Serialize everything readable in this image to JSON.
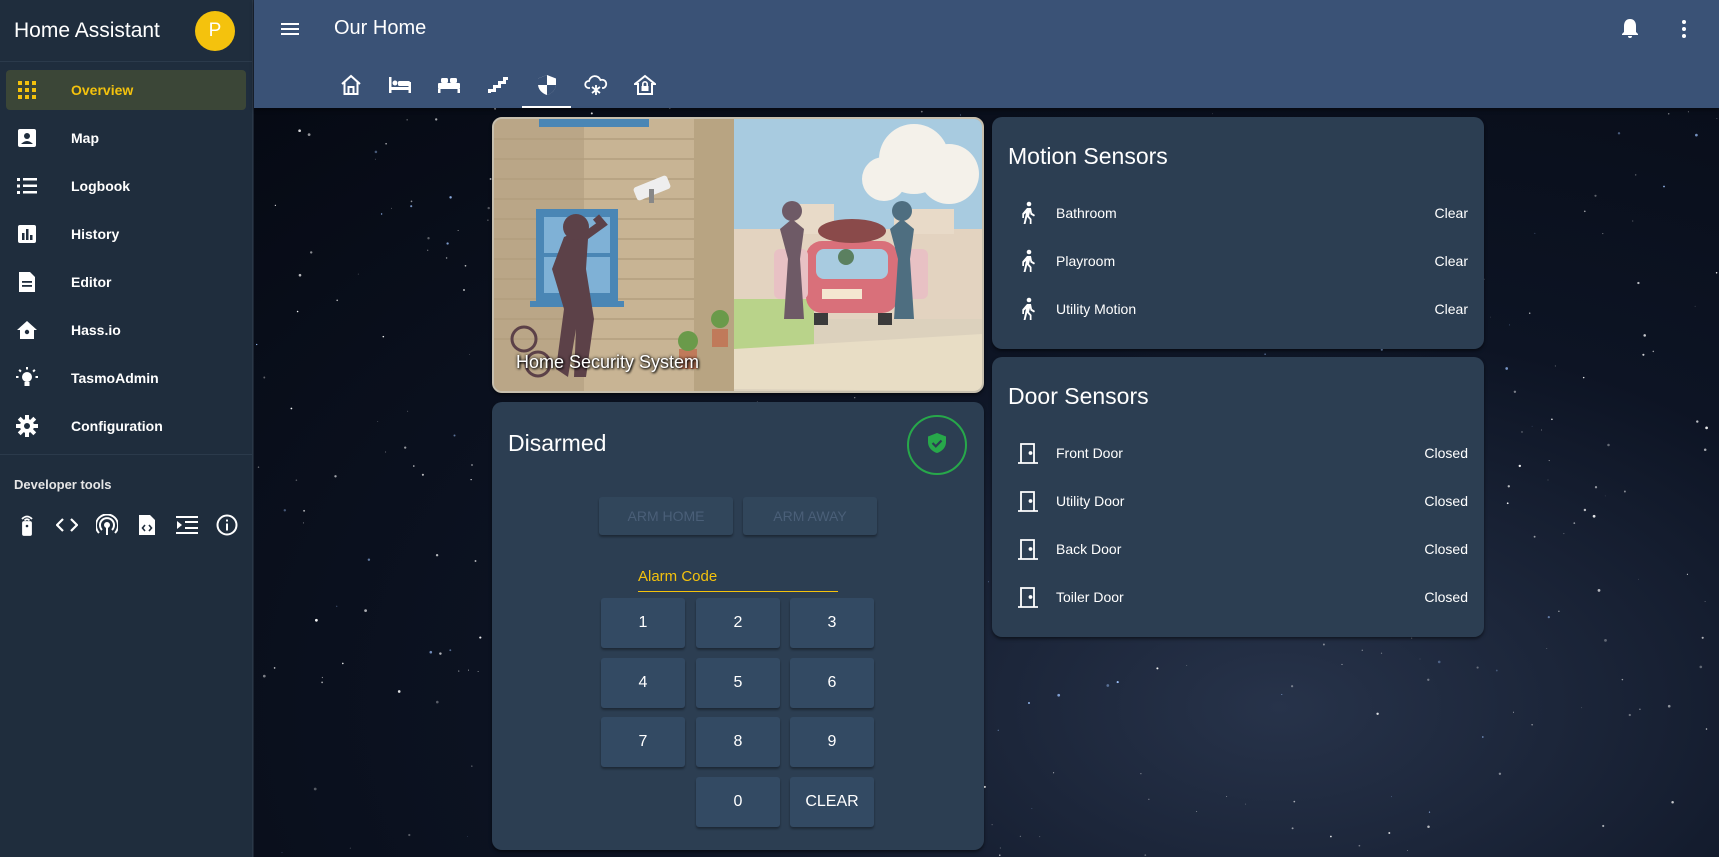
{
  "app": {
    "title": "Home Assistant",
    "avatar_letter": "P",
    "accent": "#f4c20d",
    "topbar_color": "#3a5276"
  },
  "sidebar": {
    "items": [
      {
        "label": "Overview",
        "icon": "apps-grid-icon",
        "active": true
      },
      {
        "label": "Map",
        "icon": "map-account-icon"
      },
      {
        "label": "Logbook",
        "icon": "format-list-icon"
      },
      {
        "label": "History",
        "icon": "chart-box-icon"
      },
      {
        "label": "Editor",
        "icon": "file-document-icon"
      },
      {
        "label": "Hass.io",
        "icon": "home-assistant-icon"
      },
      {
        "label": "TasmoAdmin",
        "icon": "lightbulb-icon"
      },
      {
        "label": "Configuration",
        "icon": "gear-icon"
      }
    ],
    "dev_tools_title": "Developer tools",
    "dev_tools": [
      "remote-icon",
      "code-tags-icon",
      "broadcast-icon",
      "file-code-icon",
      "template-icon",
      "info-icon"
    ]
  },
  "header": {
    "title": "Our Home",
    "tabs": [
      "home-icon",
      "bed-icon",
      "bed-double-icon",
      "stairs-icon",
      "shield-icon",
      "weather-snowy-icon",
      "home-lock-icon"
    ],
    "active_tab": 4
  },
  "picture_card": {
    "title": "Home Security System"
  },
  "alarm": {
    "state": "Disarmed",
    "status_color": "#27a84a",
    "arm_home": "ARM HOME",
    "arm_away": "ARM AWAY",
    "code_label": "Alarm Code",
    "keys": [
      "1",
      "2",
      "3",
      "4",
      "5",
      "6",
      "7",
      "8",
      "9",
      "0",
      "CLEAR"
    ]
  },
  "motion": {
    "title": "Motion Sensors",
    "rows": [
      {
        "name": "Bathroom",
        "state": "Clear"
      },
      {
        "name": "Playroom",
        "state": "Clear"
      },
      {
        "name": "Utility Motion",
        "state": "Clear"
      }
    ]
  },
  "doors": {
    "title": "Door Sensors",
    "rows": [
      {
        "name": "Front Door",
        "state": "Closed"
      },
      {
        "name": "Utility Door",
        "state": "Closed"
      },
      {
        "name": "Back Door",
        "state": "Closed"
      },
      {
        "name": "Toiler Door",
        "state": "Closed"
      }
    ]
  }
}
